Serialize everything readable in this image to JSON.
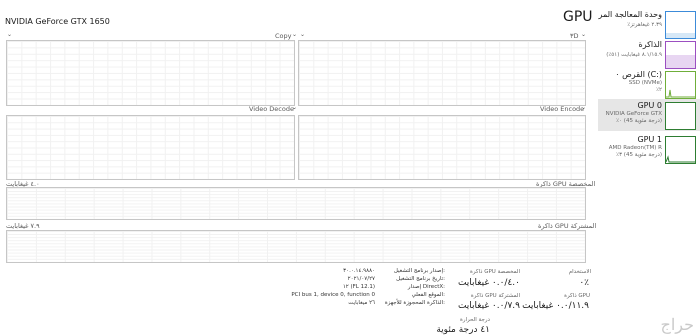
{
  "header": {
    "gpu_name": "NVIDIA GeForce GTX 1650",
    "title": "GPU"
  },
  "engines": {
    "top_left_label": "Copy",
    "top_right_label": "٣D",
    "bottom_left_label": "Video Decode",
    "bottom_right_label": "Video Encode"
  },
  "memory_graphs": {
    "dedicated_label": "ذاكرة GPU المخصصة",
    "dedicated_max": "٤.٠ غيغابايت",
    "shared_label": "ذاكرة GPU المشتركة",
    "shared_max": "٧.٩ غيغابايت"
  },
  "sidebar": {
    "items": [
      {
        "title": "وحدة المعالجة المر",
        "sub": "٪٢.٣٩ غيغاهرتز",
        "selected": false
      },
      {
        "title": "الذاكرة",
        "sub": "٨.١/١٥.٩ غيغابايت (٥١٪)",
        "selected": false
      },
      {
        "title": "القرص ٠ (C:)",
        "sub": "SSD (NVMe)",
        "sub2": "٪٢",
        "selected": false
      },
      {
        "title": "GPU 0",
        "sub": "NVIDIA GeForce GTX",
        "sub2": "٪٠ (45 درجة مئوية)",
        "selected": true
      },
      {
        "title": "GPU 1",
        "sub": "AMD Radeon(TM) R",
        "sub2": "٪٣ (45 درجة مئوية)",
        "selected": false
      }
    ]
  },
  "stats": {
    "utilization_label": "الاستخدام",
    "utilization_value": "٠٪",
    "gpu_memory_label": "ذاكرة GPU",
    "gpu_memory_value": "٠.٠/١١.٩ غيغابايت",
    "dedicated_label": "ذاكرة GPU المخصصة",
    "dedicated_value": "٠.٠/٤.٠ غيغابايت",
    "shared_label": "ذاكرة GPU المشتركة",
    "shared_value": "٠.٠/٧.٩ غيغابايت",
    "temperature_label": "درجة الحرارة",
    "temperature_value": "٤١ درجة مئوية"
  },
  "details": {
    "driver_version_label": "إصدار برنامج التشغيل:",
    "driver_version_value": "٣٠.٠.١٤.٩٨٨٠",
    "driver_date_label": "تاريخ برنامج التشغيل:",
    "driver_date_value": "٢٠٢١/٠٧/٢٧",
    "directx_label": "إصدار DirectX:",
    "directx_value": "١٢ (FL 12.1)",
    "location_label": "الموقع الفعلي:",
    "location_value": "PCI bus 1, device 0, function 0",
    "reserved_label": "الذاكرة المحجوزة للأجهزة:",
    "reserved_value": "٢٦ ميغابايت"
  },
  "watermark": "حراج"
}
